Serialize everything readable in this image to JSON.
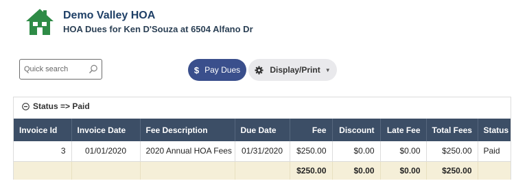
{
  "header": {
    "org_name": "Demo Valley HOA",
    "subtitle": "HOA Dues for Ken D'Souza at 6504 Alfano Dr",
    "logo_icon": "house-logo-icon",
    "brand_color": "#2e8b46"
  },
  "toolbar": {
    "search_placeholder": "Quick search",
    "pay_icon": "$",
    "pay_label": "Pay Dues",
    "display_label": "Display/Print",
    "pay_color": "#3a4f8c"
  },
  "group": {
    "label": "Status => Paid"
  },
  "table": {
    "columns": [
      "Invoice Id",
      "Invoice Date",
      "Fee Description",
      "Due Date",
      "Fee",
      "Discount",
      "Late Fee",
      "Total Fees",
      "Status"
    ],
    "rows": [
      {
        "invoice_id": "3",
        "invoice_date": "01/01/2020",
        "fee_description": "2020 Annual HOA Fees",
        "due_date": "01/31/2020",
        "fee": "$250.00",
        "discount": "$0.00",
        "late_fee": "$0.00",
        "total_fees": "$250.00",
        "status": "Paid"
      }
    ],
    "totals": {
      "fee": "$250.00",
      "discount": "$0.00",
      "late_fee": "$0.00",
      "total_fees": "$250.00"
    },
    "header_color": "#3c4e66",
    "total_row_color": "#f5efd8"
  }
}
